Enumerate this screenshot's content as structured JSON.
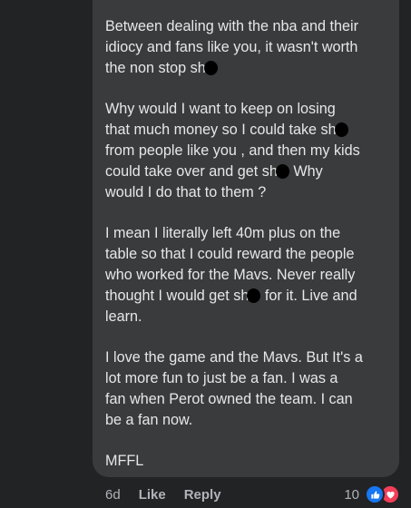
{
  "comment": {
    "paragraphs": [
      {
        "lines": [
          {
            "text": "Between dealing with the nba and their"
          },
          {
            "text": "idiocy and fans like you, it wasn't worth"
          },
          {
            "text": "the non stop sh",
            "redact_after": true,
            "tail": ""
          }
        ]
      },
      {
        "lines": [
          {
            "text": "Why would I want to keep on losing"
          },
          {
            "text": "that much money so I could take sh",
            "redact_after": true,
            "tail": ""
          },
          {
            "text": "from people like you , and then my kids"
          },
          {
            "text": "could take over and get sh",
            "redact_after": true,
            "tail": "  Why"
          },
          {
            "text": "would I do that to them ?"
          }
        ]
      },
      {
        "lines": [
          {
            "text": "I mean I literally left 40m plus on the"
          },
          {
            "text": "table so that I could reward the people"
          },
          {
            "text": "who worked for the Mavs. Never really"
          },
          {
            "text": "thought I would get sh",
            "redact_after": true,
            "tail": " for it.  Live and"
          },
          {
            "text": "learn."
          }
        ]
      },
      {
        "lines": [
          {
            "text": "I love the game and the Mavs. But It's a"
          },
          {
            "text": "lot more fun  to just be a fan. I was a"
          },
          {
            "text": "fan when  Perot owned the team.  I can"
          },
          {
            "text": "be a fan now."
          }
        ]
      },
      {
        "lines": [
          {
            "text": "MFFL"
          }
        ]
      }
    ]
  },
  "actions": {
    "age": "6d",
    "like_label": "Like",
    "reply_label": "Reply"
  },
  "reactions": {
    "count": "10",
    "icons": [
      "thumbs-up-icon",
      "heart-icon"
    ],
    "colors": {
      "like": "#1877f2",
      "love": "#f33e58"
    }
  }
}
